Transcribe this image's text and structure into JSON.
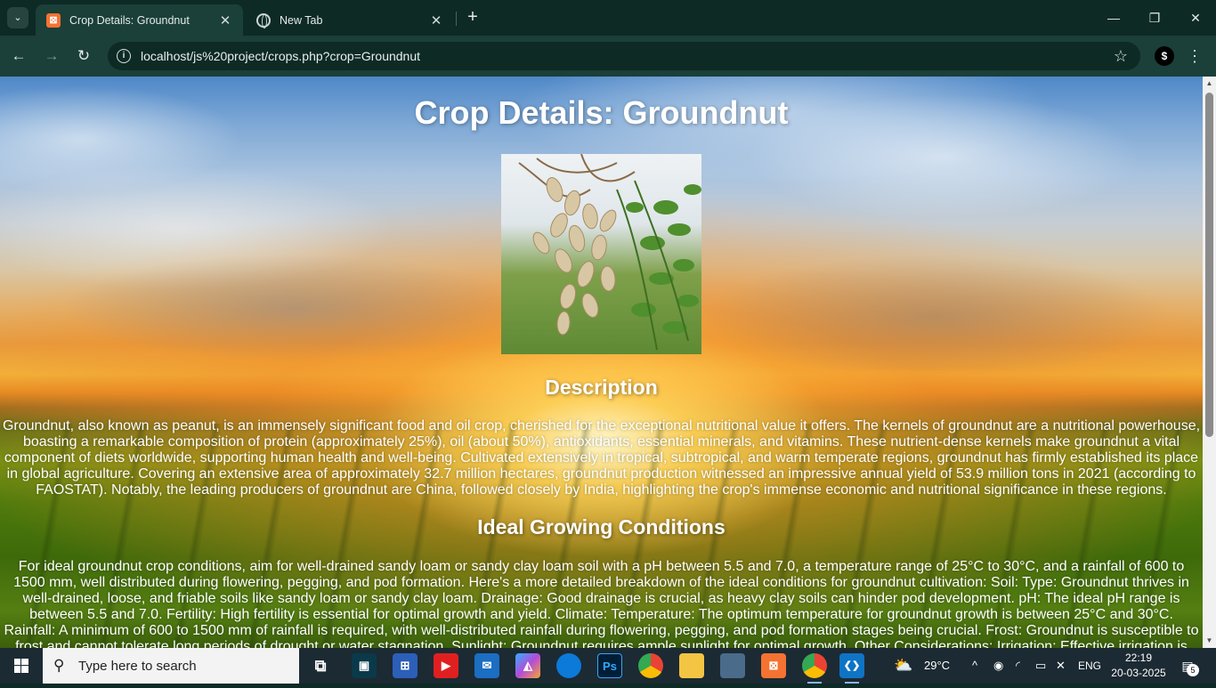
{
  "browser": {
    "tabs": [
      {
        "title": "Crop Details: Groundnut",
        "favicon": "xampp-icon",
        "favicon_glyph": "⊠",
        "active": true
      },
      {
        "title": "New Tab",
        "favicon": "globe-icon",
        "active": false
      }
    ],
    "url": "localhost/js%20project/crops.php?crop=Groundnut",
    "profile_initial": "$",
    "icons": {
      "tab_search": "⌄",
      "close": "✕",
      "new_tab": "+",
      "back": "←",
      "forward": "→",
      "reload": "↻",
      "info": "i",
      "bookmark": "☆",
      "menu": "⋮",
      "minimize": "—",
      "maximize": "❐",
      "window_close": "✕"
    }
  },
  "page": {
    "title": "Crop Details: Groundnut",
    "image_alt": "Groundnut plant",
    "description_heading": "Description",
    "description_text": "Groundnut, also known as peanut, is an immensely significant food and oil crop, cherished for the exceptional nutritional value it offers. The kernels of groundnut are a nutritional powerhouse, boasting a remarkable composition of protein (approximately 25%), oil (about 50%), antioxidants, essential minerals, and vitamins. These nutrient-dense kernels make groundnut a vital component of diets worldwide, supporting human health and well-being. Cultivated extensively in tropical, subtropical, and warm temperate regions, groundnut has firmly established its place in global agriculture. Covering an extensive area of approximately 32.7 million hectares, groundnut production witnessed an impressive annual yield of 53.9 million tons in 2021 (according to FAOSTAT). Notably, the leading producers of groundnut are China, followed closely by India, highlighting the crop's immense economic and nutritional significance in these regions.",
    "conditions_heading": "Ideal Growing Conditions",
    "conditions_text": "For ideal groundnut crop conditions, aim for well-drained sandy loam or sandy clay loam soil with a pH between 5.5 and 7.0, a temperature range of 25°C to 30°C, and a rainfall of 600 to 1500 mm, well distributed during flowering, pegging, and pod formation. Here's a more detailed breakdown of the ideal conditions for groundnut cultivation: Soil: Type: Groundnut thrives in well-drained, loose, and friable soils like sandy loam or sandy clay loam. Drainage: Good drainage is crucial, as heavy clay soils can hinder pod development. pH: The ideal pH range is between 5.5 and 7.0. Fertility: High fertility is essential for optimal growth and yield. Climate: Temperature: The optimum temperature for groundnut growth is between 25°C and 30°C. Rainfall: A minimum of 600 to 1500 mm of rainfall is required, with well-distributed rainfall during flowering, pegging, and pod formation stages being crucial. Frost: Groundnut is susceptible to frost and cannot tolerate long periods of drought or water stagnation. Sunlight: Groundnut requires ample sunlight for optimal growth. Other Considerations: Irrigation: Effective irrigation is essential"
  },
  "taskbar": {
    "search_placeholder": "Type here to search",
    "weather": "29°C",
    "language": "ENG",
    "time": "22:19",
    "date": "20-03-2025",
    "notification_count": "5",
    "icons": {
      "search": "⚲",
      "tray_chevron": "^",
      "notification": "▤",
      "task_view": "⧉",
      "store": "⊞",
      "youtube": "▶",
      "mail": "✉",
      "photoshop": "Ps",
      "xampp": "⊠",
      "vscode": "❮❯",
      "remote": "▣",
      "mirror": "◭"
    }
  }
}
